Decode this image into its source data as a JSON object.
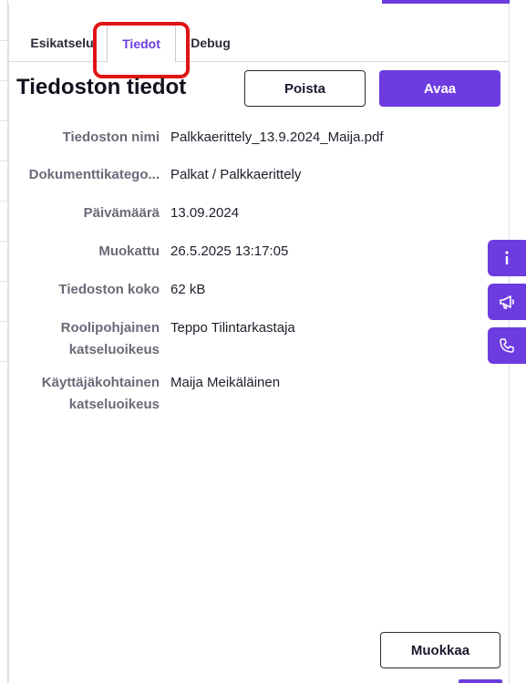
{
  "tabs": [
    {
      "label": "Esikatselu",
      "active": false
    },
    {
      "label": "Tiedot",
      "active": true
    },
    {
      "label": "Debug",
      "active": false
    }
  ],
  "header": {
    "title": "Tiedoston tiedot",
    "delete_label": "Poista",
    "open_label": "Avaa"
  },
  "details": [
    {
      "key": "Tiedoston nimi",
      "value": "Palkkaerittely_13.9.2024_Maija.pdf"
    },
    {
      "key": "Dokumenttikatego...",
      "value": "Palkat / Palkkaerittely"
    },
    {
      "key": "Päivämäärä",
      "value": "13.09.2024"
    },
    {
      "key": "Muokattu",
      "value": "26.5.2025 13:17:05"
    },
    {
      "key": "Tiedoston koko",
      "value": "62 kB"
    },
    {
      "key_line1": "Roolipohjainen",
      "key_line2": "katseluoikeus",
      "value": "Teppo Tilintarkastaja"
    },
    {
      "key_line1": "Käyttäjäkohtainen",
      "key_line2": "katseluoikeus",
      "value": "Maija Meikäläinen"
    }
  ],
  "footer": {
    "edit_label": "Muokkaa"
  },
  "side_buttons": {
    "info_icon": "info-icon",
    "announce_icon": "megaphone-icon",
    "call_icon": "phone-icon"
  },
  "colors": {
    "accent": "#6c3ce0",
    "highlight": "#e01414"
  }
}
